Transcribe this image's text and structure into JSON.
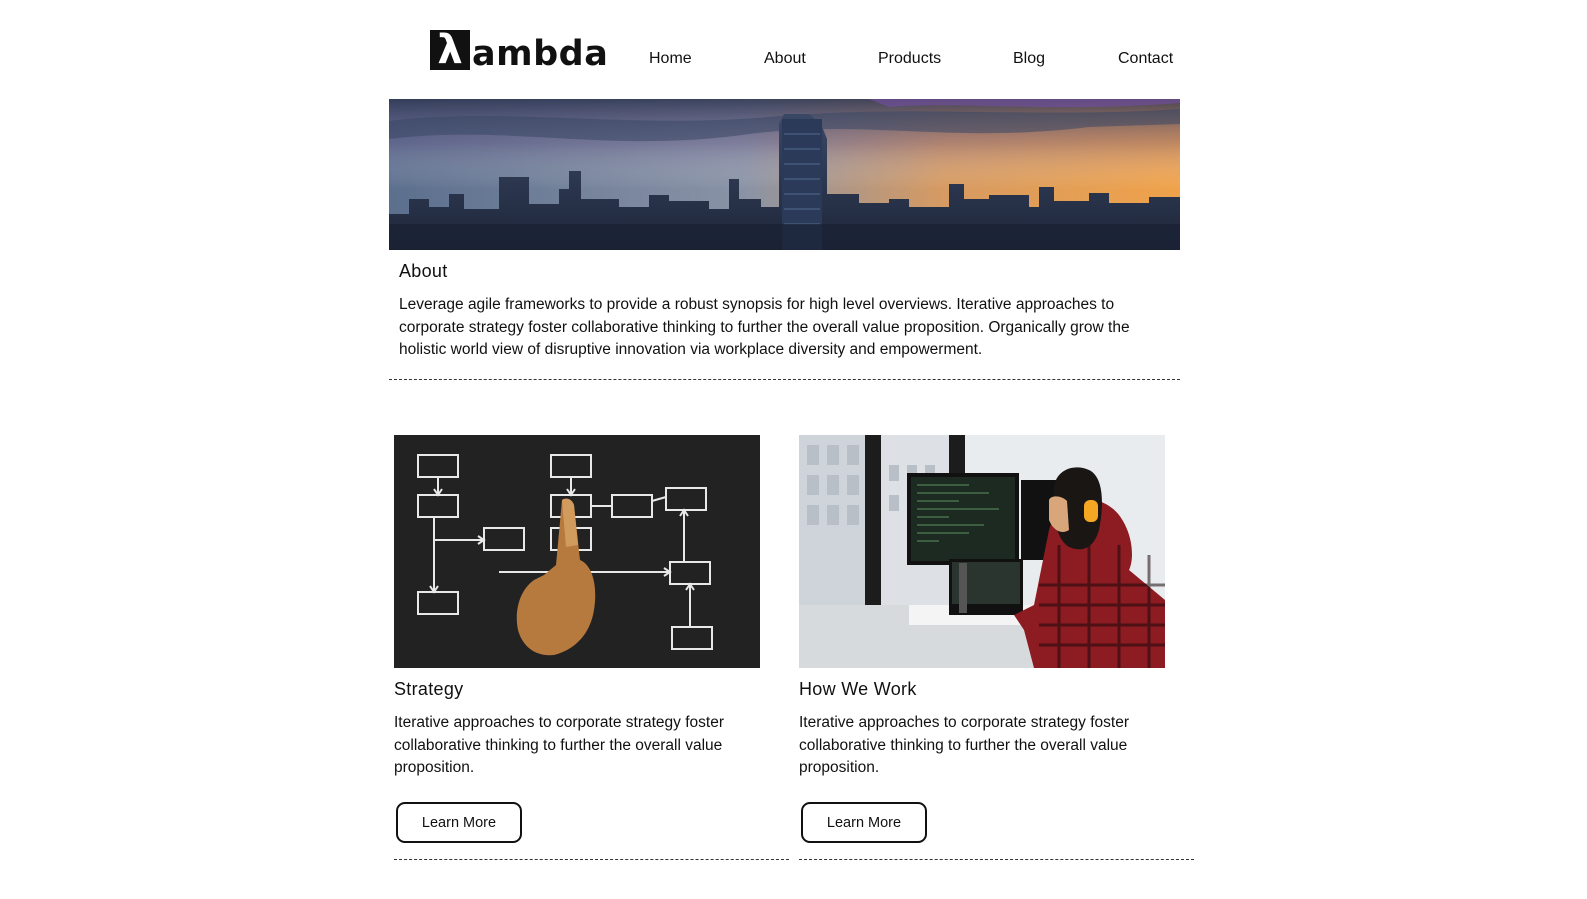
{
  "brand": {
    "logo_mark": "λ",
    "logo_text": "ambda"
  },
  "nav": {
    "items": [
      {
        "label": "Home"
      },
      {
        "label": "About"
      },
      {
        "label": "Products"
      },
      {
        "label": "Blog"
      },
      {
        "label": "Contact"
      }
    ]
  },
  "about": {
    "title": "About",
    "body": "Leverage agile frameworks to provide a robust synopsis for high level overviews. Iterative approaches to corporate strategy foster collaborative thinking to further the overall value proposition. Organically grow the holistic world view of disruptive innovation via workplace diversity and empowerment."
  },
  "cards": [
    {
      "title": "Strategy",
      "body": "Iterative approaches to corporate strategy foster collaborative thinking to further the overall value proposition.",
      "button_label": "Learn More"
    },
    {
      "title": "How We Work",
      "body": "Iterative approaches to corporate strategy foster collaborative thinking to further the overall value proposition.",
      "button_label": "Learn More"
    }
  ],
  "colors": {
    "text": "#111111",
    "background": "#ffffff",
    "divider": "#333333"
  }
}
